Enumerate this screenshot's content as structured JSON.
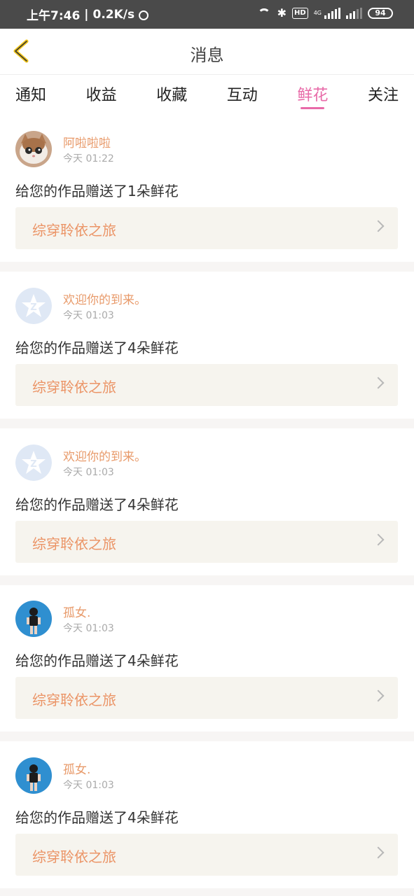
{
  "status_bar": {
    "time": "上午7:46",
    "speed": "0.2K/s",
    "hd": "HD",
    "network": "4G",
    "battery": "94"
  },
  "nav": {
    "title": "消息"
  },
  "tabs": [
    {
      "label": "通知",
      "active": false
    },
    {
      "label": "收益",
      "active": false
    },
    {
      "label": "收藏",
      "active": false
    },
    {
      "label": "互动",
      "active": false
    },
    {
      "label": "鲜花",
      "active": true
    },
    {
      "label": "关注",
      "active": false
    }
  ],
  "notifications": [
    {
      "user": "阿啦啦啦",
      "time": "今天 01:22",
      "message": "给您的作品赠送了1朵鲜花",
      "work": "综穿聆依之旅",
      "avatar": "cat-avatar"
    },
    {
      "user": "欢迎你的到来。",
      "time": "今天 01:03",
      "message": "给您的作品赠送了4朵鲜花",
      "work": "综穿聆依之旅",
      "avatar": "default-star-avatar"
    },
    {
      "user": "欢迎你的到来。",
      "time": "今天 01:03",
      "message": "给您的作品赠送了4朵鲜花",
      "work": "综穿聆依之旅",
      "avatar": "default-star-avatar"
    },
    {
      "user": "孤女.",
      "time": "今天 01:03",
      "message": "给您的作品赠送了4朵鲜花",
      "work": "综穿聆依之旅",
      "avatar": "girl-photo-avatar"
    },
    {
      "user": "孤女.",
      "time": "今天 01:03",
      "message": "给您的作品赠送了4朵鲜花",
      "work": "综穿聆依之旅",
      "avatar": "girl-photo-avatar"
    }
  ],
  "colors": {
    "accent": "#e86aa8",
    "username": "#e89a6a",
    "work_title": "#eb9466",
    "work_bg": "#f6f4ee",
    "back_arrow": "#f0c419"
  }
}
